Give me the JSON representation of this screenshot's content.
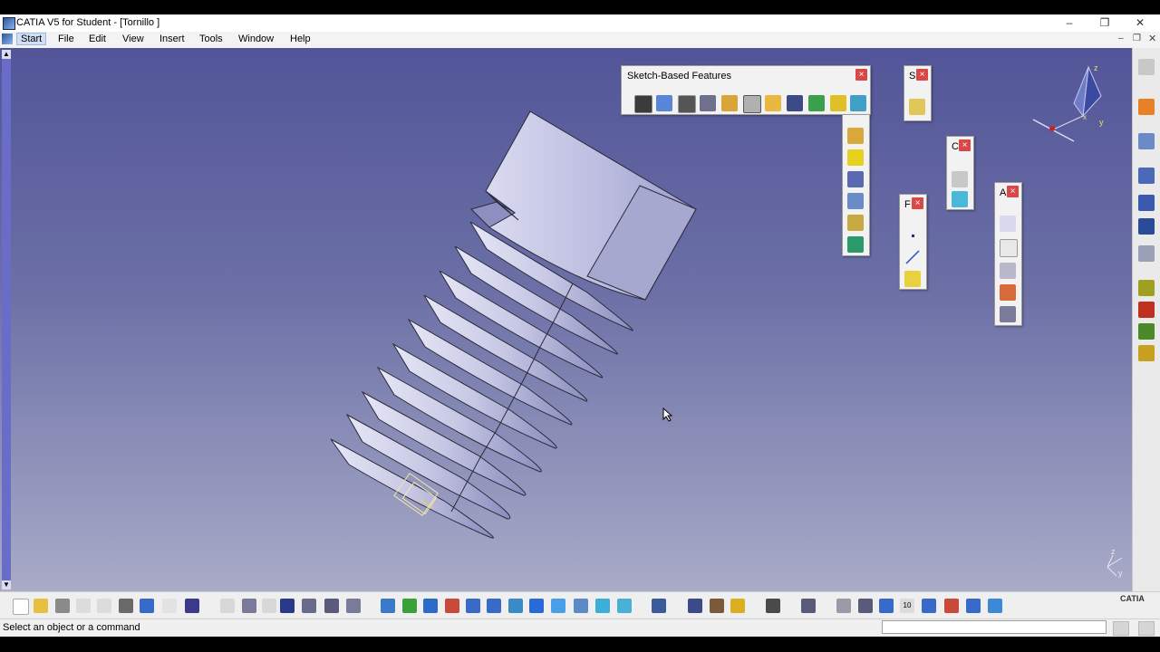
{
  "window": {
    "title": "CATIA V5 for Student - [Tornillo ]",
    "minimize_label": "–",
    "maximize_label": "❐",
    "close_label": "✕"
  },
  "menu": {
    "items": [
      "Start",
      "File",
      "Edit",
      "View",
      "Insert",
      "Tools",
      "Window",
      "Help"
    ]
  },
  "panels": {
    "sketch_based_features": {
      "title": "Sketch-Based Features"
    },
    "small_s": {
      "title": "S"
    },
    "small_c": {
      "title": "C"
    },
    "small_f": {
      "title": "F"
    },
    "small_a": {
      "title": "A"
    },
    "close_glyph": "×"
  },
  "compass": {
    "z_label": "z",
    "y_label": "y",
    "x_label": "x"
  },
  "axis_indicator": {
    "z_label": "z",
    "y_label": "y"
  },
  "status": {
    "message": "Select an object or a command",
    "command_input": ""
  },
  "brand": {
    "label": "CATIA"
  },
  "colors": {
    "viewport_top": "#525598",
    "viewport_bottom": "#a9abc8",
    "part_face": "#c9c9e6",
    "part_shadow": "#8d8fc0",
    "scrollbar": "#6a6dc7"
  }
}
